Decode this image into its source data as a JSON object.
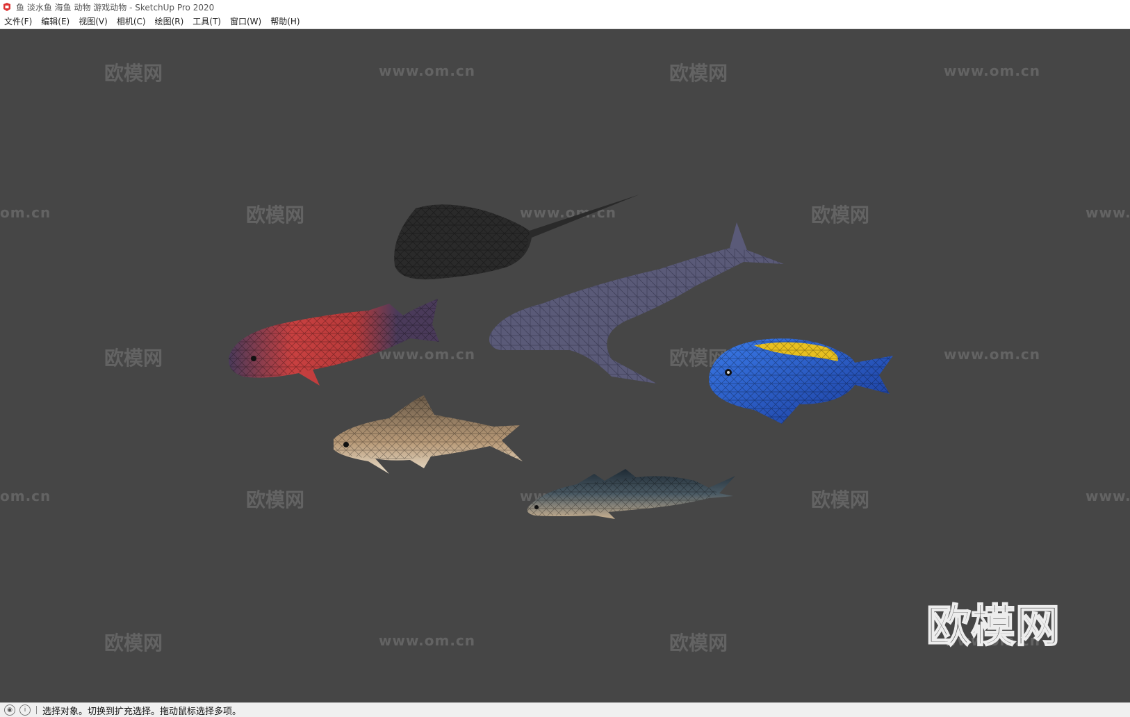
{
  "window": {
    "title": "鱼 淡水鱼 海鱼 动物 游戏动物 - SketchUp Pro 2020"
  },
  "menu": [
    {
      "label": "文件(F)"
    },
    {
      "label": "编辑(E)"
    },
    {
      "label": "视图(V)"
    },
    {
      "label": "相机(C)"
    },
    {
      "label": "绘图(R)"
    },
    {
      "label": "工具(T)"
    },
    {
      "label": "窗口(W)"
    },
    {
      "label": "帮助(H)"
    }
  ],
  "watermark": {
    "cn": "欧模网",
    "url": "www.om.cn",
    "url_partial_left": "om.cn",
    "url_partial_right": "www."
  },
  "status": {
    "text": "选择对象。切换到扩充选择。拖动鼠标选择多项。"
  },
  "colors": {
    "viewport": "#464646",
    "stingray": "#2a2a2a",
    "whale": "#5a5a78",
    "tang_blue": "#1e5fd0",
    "tang_yellow": "#e8c020",
    "red_fish": "#c84040"
  },
  "icons": [
    "sketchup-logo-icon",
    "geo-location-icon",
    "info-icon"
  ]
}
